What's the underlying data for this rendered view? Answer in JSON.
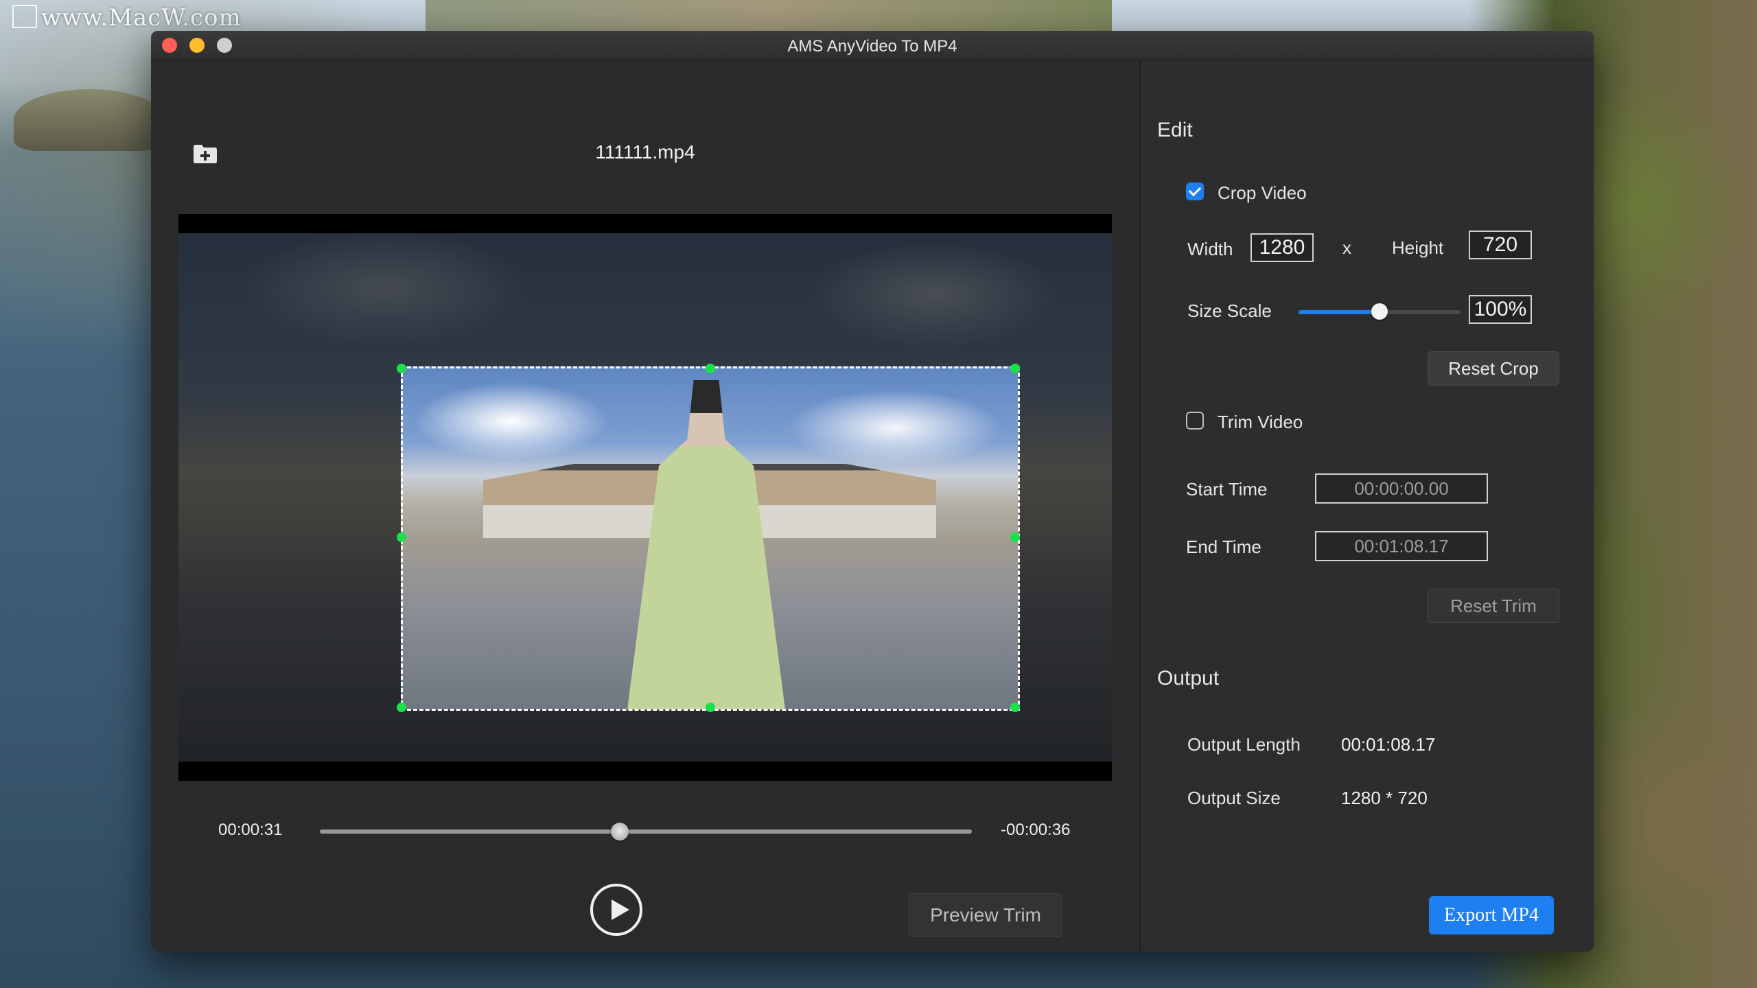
{
  "desktop": {
    "watermark": "www.MacW.com"
  },
  "window": {
    "title": "AMS AnyVideo To MP4"
  },
  "player": {
    "file_name": "111111.mp4",
    "current_time": "00:00:31",
    "remaining_time": "-00:00:36",
    "progress_fraction": 0.46,
    "preview_trim_label": "Preview Trim"
  },
  "edit": {
    "title": "Edit",
    "crop_video": {
      "label": "Crop Video",
      "checked": true,
      "width_label": "Width",
      "width_value": "1280",
      "x_label": "x",
      "height_label": "Height",
      "height_value": "720",
      "size_scale_label": "Size Scale",
      "size_scale_value": "100%",
      "size_scale_fraction": 0.5,
      "reset_crop_label": "Reset Crop"
    },
    "trim_video": {
      "label": "Trim Video",
      "checked": false,
      "start_time_label": "Start Time",
      "start_time_value": "00:00:00.00",
      "end_time_label": "End Time",
      "end_time_value": "00:01:08.17",
      "reset_trim_label": "Reset Trim"
    }
  },
  "output": {
    "title": "Output",
    "length_label": "Output Length",
    "length_value": "00:01:08.17",
    "size_label": "Output Size",
    "size_value": "1280 * 720",
    "export_label": "Export MP4"
  },
  "colors": {
    "accent": "#1e7ff0",
    "crop_handle": "#18e14a",
    "window_bg": "#2d2d2d"
  }
}
